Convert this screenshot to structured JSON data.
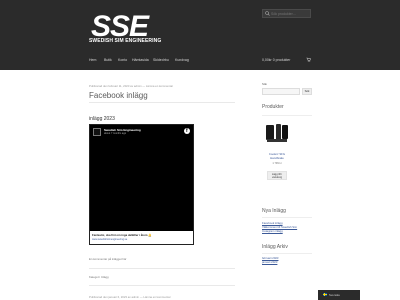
{
  "header": {
    "logo_text": "SSE",
    "brand": "SWEDISH SIM ENGINEERING",
    "search_placeholder": "Sök produkter…",
    "nav": [
      "Hem",
      "Butik",
      "Konto",
      "Hämtasida",
      "Skidedrbu",
      "Kundvag"
    ],
    "cart": "0,00kr   0 produkter"
  },
  "main": {
    "meta": "Publicerad den februari 11, 2023 av admin — Lämna en kommentar",
    "title": "Facebook inlägg",
    "subtitle": "inlägg 2023",
    "fb": {
      "page_name": "Swedish Sim Engineering",
      "time": "about 7 months ago",
      "caption": "Fantastic, ska fint om inga delkiller i åtom 🔔",
      "link": "www.swedishsimengineering.se"
    },
    "after_text": "En kommentar på inlägget här",
    "category": "Kategori: Inlägg",
    "meta2": "Publicerad den januari 6, 2023 av admin — Lämna en kommentar"
  },
  "sidebar": {
    "search_label": "Sök",
    "search_button": "Sök",
    "products_heading": "Produkter",
    "product": {
      "name": "Coolerz SFG Handbrake",
      "price": "1 799 kr",
      "button": "Lägg till i varukorg"
    },
    "recent_heading": "Nya Inlägg",
    "recent": [
      "Facebook inlägg",
      "Välkommen till Swedish Sim",
      "Instagram inlägg"
    ],
    "archive_heading": "Inlägg Arkiv",
    "archive": [
      "februari 2023",
      "januari 2023"
    ]
  },
  "footer": {
    "lang": "Svenska"
  }
}
